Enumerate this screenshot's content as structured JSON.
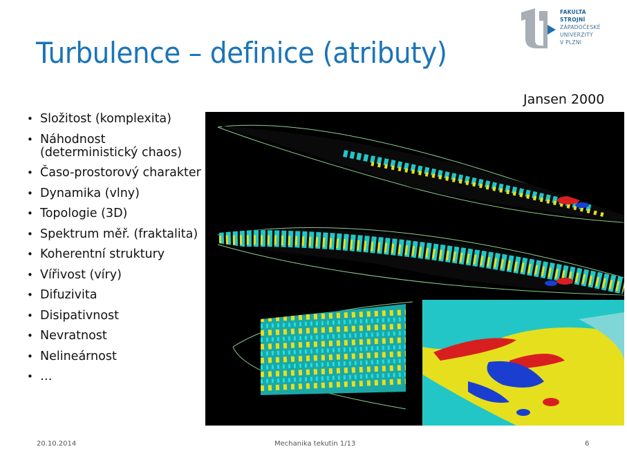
{
  "slide": {
    "title": "Turbulence – definice (atributy)",
    "citation": "Jansen 2000",
    "bullets": [
      "Složitost (komplexita)",
      "Náhodnost (deterministický chaos)",
      "Časo-prostorový charakter",
      "Dynamika (vlny)",
      "Topologie (3D)",
      "Spektrum měř. (fraktalita)",
      "Koherentní struktury",
      "Vířivost (víry)",
      "Difuzivita",
      "Disipativnost",
      "Nevratnost",
      "Nelineárnost",
      "…"
    ]
  },
  "logo": {
    "line1": "FAKULTA STROJNÍ",
    "line2": "ZÁPADOČESKÉ",
    "line3": "UNIVERZITY",
    "line4": "V PLZNI",
    "color": "#1e5f93",
    "mark_color": "#9aa3ab"
  },
  "footer": {
    "date": "20.10.2014",
    "course": "Mechanika tekutin 1/13",
    "page": "6"
  },
  "colors": {
    "title": "#1b74b8",
    "figure_background": "#000000",
    "vortex_cyan": "#22c6c6",
    "vortex_yellow": "#e6df1e",
    "vortex_red": "#d81f1f",
    "vortex_blue": "#1a3fd0",
    "outline_green": "#8fd08f"
  }
}
